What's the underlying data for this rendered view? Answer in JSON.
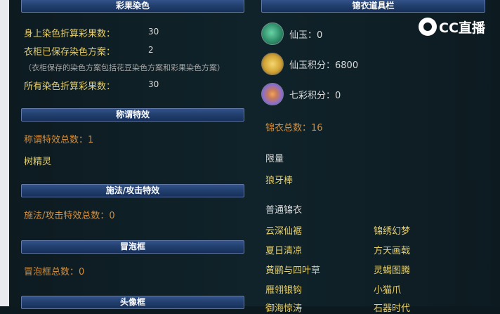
{
  "left": {
    "sections": [
      {
        "title": "彩果染色"
      },
      {
        "title": "称谓特效"
      },
      {
        "title": "施法/攻击特效"
      },
      {
        "title": "冒泡框"
      },
      {
        "title": "头像框"
      }
    ],
    "dye": {
      "body_label": "身上染色折算彩果数：",
      "body_value": "30",
      "wardrobe_label": "衣柜已保存染色方案：",
      "wardrobe_value": "2",
      "note": "（衣柜保存的染色方案包括花豆染色方案和彩果染色方案）",
      "total_label": "所有染色折算彩果数：",
      "total_value": "30"
    },
    "title_effect": {
      "count": "称谓特效总数：1",
      "item": "树精灵"
    },
    "cast_effect": {
      "count": "施法/攻击特效总数：0"
    },
    "bubble": {
      "count": "冒泡框总数：0"
    }
  },
  "right": {
    "header": "锦衣道具栏",
    "currencies": [
      {
        "label": "仙玉：0",
        "icon": "jade-icon",
        "color": "#2f8e6a"
      },
      {
        "label": "仙玉积分：6800",
        "icon": "jade-points-card-icon",
        "color": "#d2a437"
      },
      {
        "label": "七彩积分：0",
        "icon": "rainbow-points-icon",
        "color": "#8a6dd0"
      }
    ],
    "total": "锦衣总数：16",
    "limited_label": "限量",
    "limited_items": [
      "狼牙棒"
    ],
    "normal_label": "普通锦衣",
    "normal_col1": [
      "云深仙裾",
      "夏日清凉",
      "黄鹂与四叶草",
      "雁翎银钩",
      "御海惊涛"
    ],
    "normal_col2": [
      "锦绣幻梦",
      "方天画戟",
      "灵蝎图腾",
      "小猫爪",
      "石器时代"
    ]
  },
  "watermark": {
    "text": "CC直播"
  }
}
